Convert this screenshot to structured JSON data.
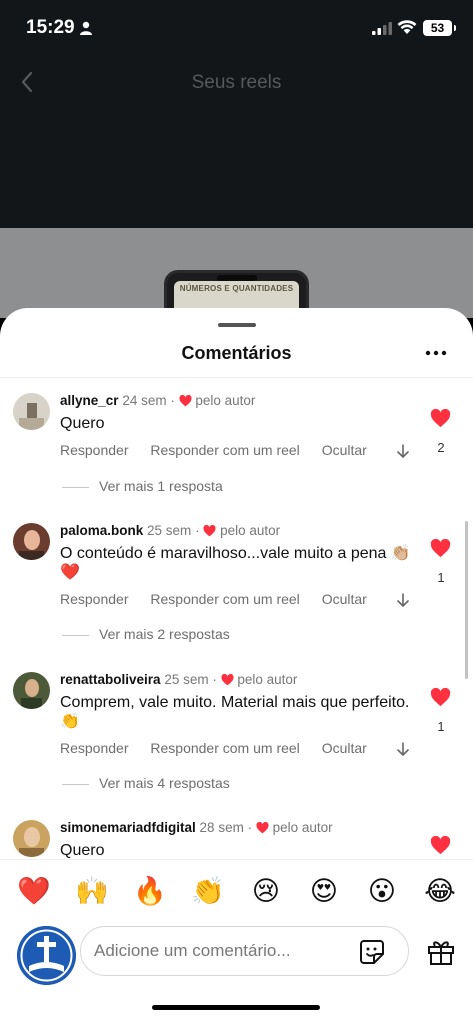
{
  "status_bar": {
    "time": "15:29",
    "battery": "53"
  },
  "topbar": {
    "title": "Seus reels"
  },
  "preview": {
    "screen_text": "NÚMEROS E QUANTIDADES"
  },
  "sheet": {
    "title": "Comentários"
  },
  "actions": {
    "reply": "Responder",
    "reply_reel": "Responder com um reel",
    "hide": "Ocultar"
  },
  "comments": [
    {
      "username": "allyne_cr",
      "age": "24 sem",
      "author_label": "pelo autor",
      "text": "Quero",
      "likes": "2",
      "replies": "Ver mais 1 resposta"
    },
    {
      "username": "paloma.bonk",
      "age": "25 sem",
      "author_label": "pelo autor",
      "text": "O conteúdo é maravilhoso...vale muito a pena 👏🏼❤️",
      "likes": "1",
      "replies": "Ver mais 2 respostas"
    },
    {
      "username": "renattaboliveira",
      "age": "25 sem",
      "author_label": "pelo autor",
      "text": "Comprem, vale muito. Material mais que perfeito.👏",
      "likes": "1",
      "replies": "Ver mais 4 respostas"
    },
    {
      "username": "simonemariadfdigital",
      "age": "28 sem",
      "author_label": "pelo autor",
      "text": "Quero"
    }
  ],
  "emojis": [
    "❤️",
    "🙌",
    "🔥",
    "👏",
    "😢",
    "😍",
    "😮",
    "😂"
  ],
  "composer": {
    "placeholder": "Adicione um comentário..."
  },
  "icons": [
    "person-icon",
    "signal-icon",
    "wifi-icon",
    "back-icon",
    "more-icon",
    "heart-icon",
    "arrow-down-icon",
    "sticker-icon",
    "gift-icon"
  ],
  "colors": {
    "like_red": "#ff3040",
    "sheet_bg": "#ffffff",
    "header_bg": "#121619"
  }
}
